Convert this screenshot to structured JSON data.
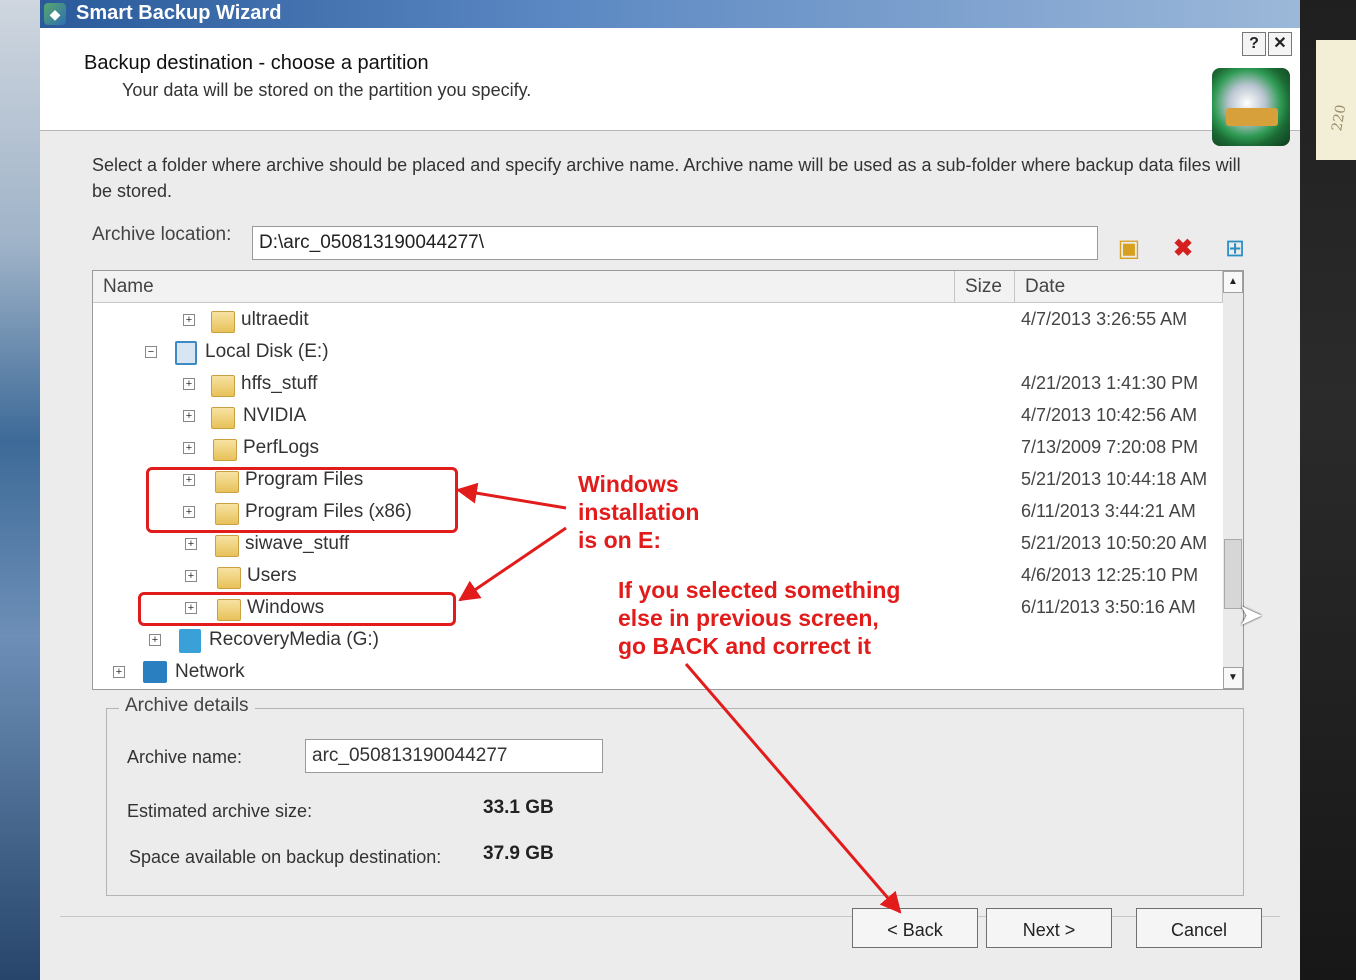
{
  "window": {
    "title": "Smart Backup Wizard",
    "help_label": "?",
    "close_label": "✕"
  },
  "header": {
    "title": "Backup destination - choose a partition",
    "subtitle": "Your data will be stored on the partition you specify."
  },
  "instructions": "Select a folder where archive should be placed and specify archive name. Archive name will be used as a sub-folder where backup data files will be stored.",
  "archive_location": {
    "label": "Archive location:",
    "value": "D:\\arc_050813190044277\\"
  },
  "toolbar": {
    "new_folder_icon": "new-folder-icon",
    "delete_icon": "delete-icon",
    "network_icon": "network-drive-icon"
  },
  "tree": {
    "columns": {
      "name": "Name",
      "size": "Size",
      "date": "Date"
    },
    "rows": [
      {
        "name": "ultraedit",
        "date": "4/7/2013 3:26:55 AM"
      },
      {
        "name": "Local Disk (E:)",
        "date": ""
      },
      {
        "name": "hffs_stuff",
        "date": "4/21/2013 1:41:30 PM"
      },
      {
        "name": "NVIDIA",
        "date": "4/7/2013 10:42:56 AM"
      },
      {
        "name": "PerfLogs",
        "date": "7/13/2009 7:20:08 PM"
      },
      {
        "name": "Program Files",
        "date": "5/21/2013 10:44:18 AM"
      },
      {
        "name": "Program Files (x86)",
        "date": "6/11/2013 3:44:21 AM"
      },
      {
        "name": "siwave_stuff",
        "date": "5/21/2013 10:50:20 AM"
      },
      {
        "name": "Users",
        "date": "4/6/2013 12:25:10 PM"
      },
      {
        "name": "Windows",
        "date": "6/11/2013 3:50:16 AM"
      },
      {
        "name": "RecoveryMedia (G:)",
        "date": ""
      },
      {
        "name": "Network",
        "date": ""
      }
    ]
  },
  "details": {
    "legend": "Archive details",
    "name_label": "Archive name:",
    "name_value": "arc_050813190044277",
    "size_label": "Estimated archive size:",
    "size_value": "33.1 GB",
    "space_label": "Space available on backup destination:",
    "space_value": "37.9 GB"
  },
  "buttons": {
    "back": "< Back",
    "next": "Next >",
    "cancel": "Cancel"
  },
  "annotations": {
    "note1": "Windows\ninstallation\nis on E:",
    "note2": "If you selected something\nelse in previous screen,\ngo BACK and correct it",
    "color": "#e21b1b"
  },
  "sticky_note": "220"
}
